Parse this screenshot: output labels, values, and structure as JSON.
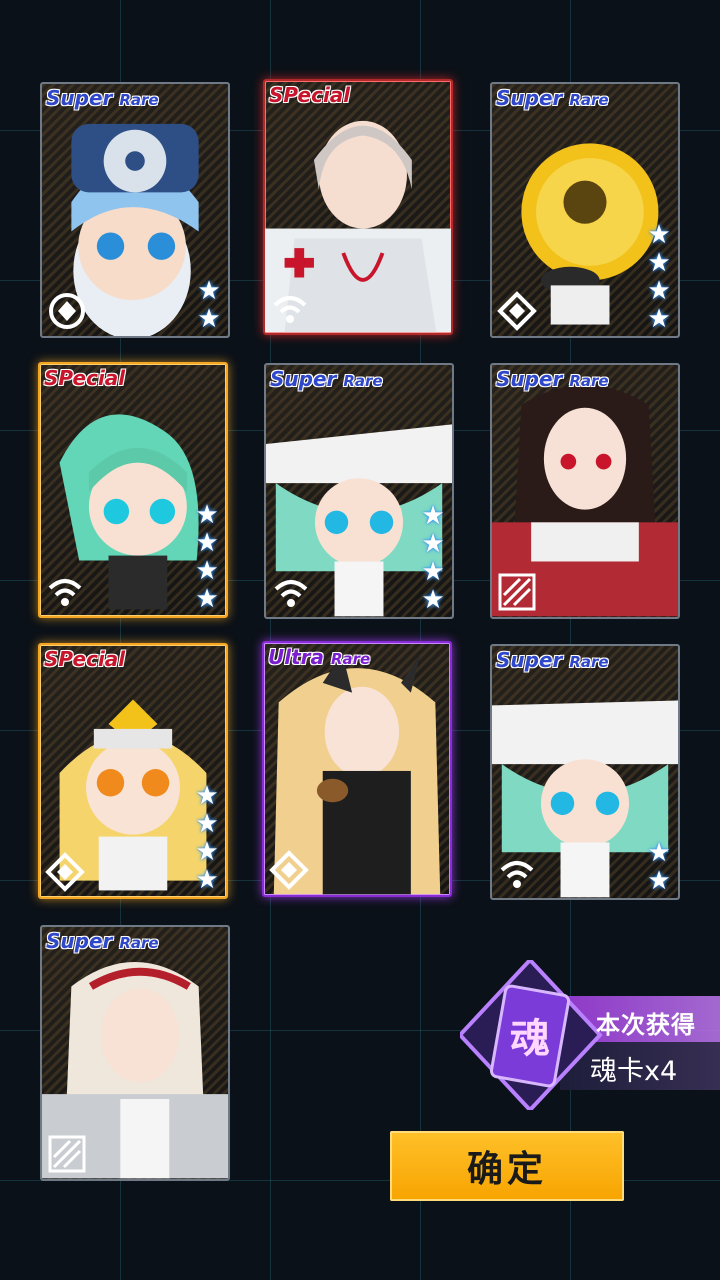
{
  "cards": [
    {
      "rarity_label": "Super Rare",
      "rarity_main": "Super ",
      "rarity_sub": "Rare",
      "stars": [
        "★",
        "★"
      ],
      "class_icon": "shield-class-icon"
    },
    {
      "rarity_label": "SPecial",
      "rarity_main": "SPecial",
      "rarity_sub": "",
      "stars": [],
      "class_icon": "signal-class-icon"
    },
    {
      "rarity_label": "Super Rare",
      "rarity_main": "Super ",
      "rarity_sub": "Rare",
      "stars": [
        "★",
        "★",
        "★",
        "★"
      ],
      "class_icon": "diamond-class-icon"
    },
    {
      "rarity_label": "SPecial",
      "rarity_main": "SPecial",
      "rarity_sub": "",
      "stars": [
        "★",
        "★",
        "★",
        "★"
      ],
      "class_icon": "signal-class-icon"
    },
    {
      "rarity_label": "Super Rare",
      "rarity_main": "Super ",
      "rarity_sub": "Rare",
      "stars": [
        "★",
        "★",
        "★",
        "★"
      ],
      "class_icon": "signal-class-icon"
    },
    {
      "rarity_label": "Super Rare",
      "rarity_main": "Super ",
      "rarity_sub": "Rare",
      "stars": [],
      "class_icon": "slash-class-icon"
    },
    {
      "rarity_label": "SPecial",
      "rarity_main": "SPecial",
      "rarity_sub": "",
      "stars": [
        "★",
        "★",
        "★",
        "★"
      ],
      "class_icon": "diamond-class-icon"
    },
    {
      "rarity_label": "Ultra Rare",
      "rarity_main": "Ultra ",
      "rarity_sub": "Rare",
      "stars": [],
      "class_icon": "diamond-class-icon"
    },
    {
      "rarity_label": "Super Rare",
      "rarity_main": "Super ",
      "rarity_sub": "Rare",
      "stars": [
        "★",
        "★"
      ],
      "class_icon": "signal-class-icon"
    },
    {
      "rarity_label": "Super Rare",
      "rarity_main": "Super ",
      "rarity_sub": "Rare",
      "stars": [],
      "class_icon": "slash-class-icon"
    }
  ],
  "soul": {
    "badge_char": "魂",
    "title": "本次获得",
    "count": "魂卡x4"
  },
  "confirm_label": "确定"
}
